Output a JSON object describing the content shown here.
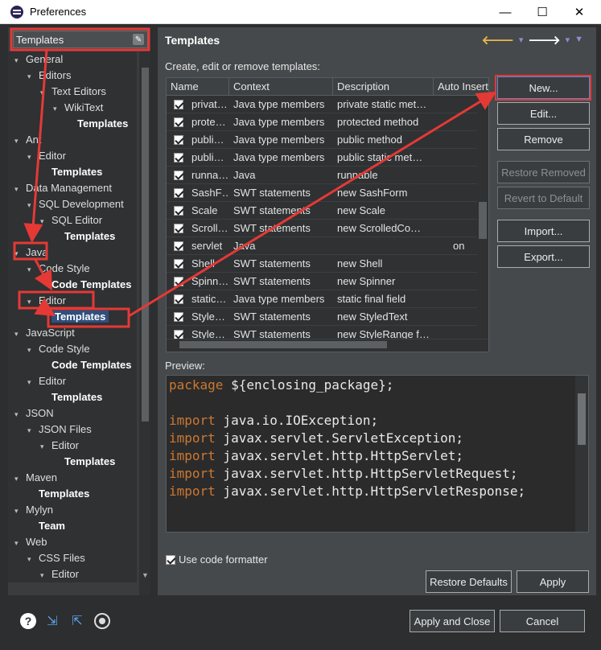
{
  "window": {
    "title": "Preferences",
    "minimize_glyph": "—",
    "maximize_glyph": "☐",
    "close_glyph": "✕"
  },
  "filter": {
    "value": "Templates"
  },
  "tree": [
    {
      "label": "General",
      "level": 1,
      "expanded": true,
      "bold": false
    },
    {
      "label": "Editors",
      "level": 2,
      "expanded": true,
      "bold": false
    },
    {
      "label": "Text Editors",
      "level": 3,
      "expanded": true,
      "bold": false
    },
    {
      "label": "WikiText",
      "level": 4,
      "expanded": true,
      "bold": false
    },
    {
      "label": "Templates",
      "level": 5,
      "bold": true
    },
    {
      "label": "Ant",
      "level": 1,
      "expanded": true,
      "bold": false
    },
    {
      "label": "Editor",
      "level": 2,
      "expanded": true,
      "bold": false
    },
    {
      "label": "Templates",
      "level": 3,
      "bold": true
    },
    {
      "label": "Data Management",
      "level": 1,
      "expanded": true,
      "bold": false
    },
    {
      "label": "SQL Development",
      "level": 2,
      "expanded": true,
      "bold": false
    },
    {
      "label": "SQL Editor",
      "level": 3,
      "expanded": true,
      "bold": false
    },
    {
      "label": "Templates",
      "level": 4,
      "bold": true
    },
    {
      "label": "Java",
      "level": 1,
      "expanded": true,
      "bold": false
    },
    {
      "label": "Code Style",
      "level": 2,
      "expanded": true,
      "bold": false
    },
    {
      "label": "Code Templates",
      "level": 3,
      "bold": true
    },
    {
      "label": "Editor",
      "level": 2,
      "expanded": true,
      "bold": false
    },
    {
      "label": "Templates",
      "level": 3,
      "bold": true,
      "selected": true
    },
    {
      "label": "JavaScript",
      "level": 1,
      "expanded": true,
      "bold": false
    },
    {
      "label": "Code Style",
      "level": 2,
      "expanded": true,
      "bold": false
    },
    {
      "label": "Code Templates",
      "level": 3,
      "bold": true
    },
    {
      "label": "Editor",
      "level": 2,
      "expanded": true,
      "bold": false
    },
    {
      "label": "Templates",
      "level": 3,
      "bold": true
    },
    {
      "label": "JSON",
      "level": 1,
      "expanded": true,
      "bold": false
    },
    {
      "label": "JSON Files",
      "level": 2,
      "expanded": true,
      "bold": false
    },
    {
      "label": "Editor",
      "level": 3,
      "expanded": true,
      "bold": false
    },
    {
      "label": "Templates",
      "level": 4,
      "bold": true
    },
    {
      "label": "Maven",
      "level": 1,
      "expanded": true,
      "bold": false
    },
    {
      "label": "Templates",
      "level": 2,
      "bold": true
    },
    {
      "label": "Mylyn",
      "level": 1,
      "expanded": true,
      "bold": false
    },
    {
      "label": "Team",
      "level": 2,
      "bold": true
    },
    {
      "label": "Web",
      "level": 1,
      "expanded": true,
      "bold": false
    },
    {
      "label": "CSS Files",
      "level": 2,
      "expanded": true,
      "bold": false
    },
    {
      "label": "Editor",
      "level": 3,
      "expanded": true,
      "bold": false
    }
  ],
  "page": {
    "title": "Templates",
    "instructions": "Create, edit or remove templates:",
    "preview_label": "Preview:",
    "use_code_formatter_label": "Use code formatter"
  },
  "table": {
    "columns": [
      "Name",
      "Context",
      "Description",
      "Auto Insert"
    ],
    "rows": [
      {
        "name": "privat…",
        "context": "Java type members",
        "description": "private static met…",
        "auto": ""
      },
      {
        "name": "prote…",
        "context": "Java type members",
        "description": "protected method",
        "auto": ""
      },
      {
        "name": "publi…",
        "context": "Java type members",
        "description": "public method",
        "auto": ""
      },
      {
        "name": "publi…",
        "context": "Java type members",
        "description": "public static met…",
        "auto": ""
      },
      {
        "name": "runna…",
        "context": "Java",
        "description": "runnable",
        "auto": ""
      },
      {
        "name": "SashF…",
        "context": "SWT statements",
        "description": "new SashForm",
        "auto": ""
      },
      {
        "name": "Scale",
        "context": "SWT statements",
        "description": "new Scale",
        "auto": ""
      },
      {
        "name": "Scroll…",
        "context": "SWT statements",
        "description": "new ScrolledCo…",
        "auto": ""
      },
      {
        "name": "servlet",
        "context": "Java",
        "description": "",
        "auto": "on"
      },
      {
        "name": "Shell",
        "context": "SWT statements",
        "description": "new Shell",
        "auto": ""
      },
      {
        "name": "Spinn…",
        "context": "SWT statements",
        "description": "new Spinner",
        "auto": ""
      },
      {
        "name": "static…",
        "context": "Java type members",
        "description": "static final field",
        "auto": ""
      },
      {
        "name": "Style…",
        "context": "SWT statements",
        "description": "new StyledText",
        "auto": ""
      },
      {
        "name": "Style…",
        "context": "SWT statements",
        "description": "new StyleRange f…",
        "auto": ""
      }
    ]
  },
  "buttons": {
    "new": "New...",
    "edit": "Edit...",
    "remove": "Remove",
    "restore_removed": "Restore Removed",
    "revert_default": "Revert to Default",
    "import": "Import...",
    "export": "Export...",
    "restore_defaults": "Restore Defaults",
    "apply": "Apply",
    "apply_close": "Apply and Close",
    "cancel": "Cancel"
  },
  "preview_code": [
    {
      "kw": "package",
      "rest": " ${enclosing_package};"
    },
    {
      "kw": "",
      "rest": ""
    },
    {
      "kw": "import",
      "rest": " java.io.IOException;"
    },
    {
      "kw": "import",
      "rest": " javax.servlet.ServletException;"
    },
    {
      "kw": "import",
      "rest": " javax.servlet.http.HttpServlet;"
    },
    {
      "kw": "import",
      "rest": " javax.servlet.http.HttpServletRequest;"
    },
    {
      "kw": "import",
      "rest": " javax.servlet.http.HttpServletResponse;"
    }
  ],
  "colors": {
    "annotation": "#e53935",
    "keyword": "#cc7832",
    "selection": "#2f4f7f"
  },
  "icons": [
    "help-icon",
    "import-icon",
    "export-icon",
    "record-icon",
    "back-arrow-icon",
    "forward-arrow-icon",
    "view-menu-icon"
  ]
}
